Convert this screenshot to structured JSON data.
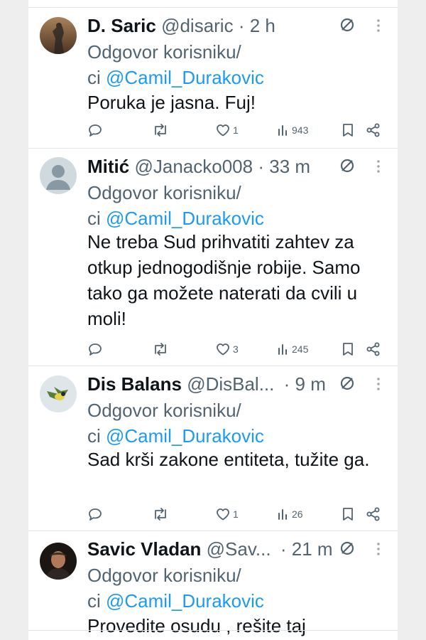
{
  "tweets": [
    {
      "author_name": "D. Saric",
      "handle": "@disaric",
      "time": "2 h",
      "reply_label": "Odgovor korisniku/",
      "reply_label_tail": "ci",
      "reply_to": "@Camil_Durakovic",
      "text": "Poruka je jasna. Fuj!",
      "replies": "",
      "retweets": "",
      "likes": "1",
      "views": "943"
    },
    {
      "author_name": "Mitić",
      "handle": "@Janacko008",
      "time": "33 m",
      "reply_label": "Odgovor korisniku/",
      "reply_label_tail": "ci",
      "reply_to": "@Camil_Durakovic",
      "text": "Ne treba Sud prihvatiti zahtev za otkup jednogodišnje robije. Samo tako ga možete naterati da cvili u moli!",
      "replies": "",
      "retweets": "",
      "likes": "3",
      "views": "245"
    },
    {
      "author_name": "Dis Balans",
      "handle": "@DisBal...",
      "time": "9 m",
      "reply_label": "Odgovor korisniku/",
      "reply_label_tail": "ci",
      "reply_to": "@Camil_Durakovic",
      "text": "Sad krši zakone entiteta, tužite ga.",
      "replies": "",
      "retweets": "",
      "likes": "1",
      "views": "26"
    },
    {
      "author_name": "Savic Vladan",
      "handle": "@Sav...",
      "time": "21 m",
      "reply_label": "Odgovor korisniku/",
      "reply_label_tail": "ci",
      "reply_to": "@Camil_Durakovic",
      "text": "Provedite osudu , rešite taj",
      "replies": "",
      "retweets": "",
      "likes": "",
      "views": ""
    }
  ],
  "colors": {
    "text": "#0f1419",
    "secondary": "#536471",
    "link": "#1d9bf0",
    "divider": "#e1e5e8"
  }
}
